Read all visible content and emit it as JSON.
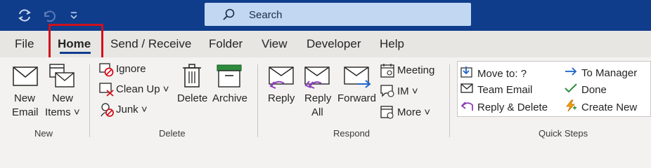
{
  "titlebar": {
    "sync_icon": "sync-icon",
    "undo_icon": "undo-icon",
    "customize_icon": "customize-quick-access-icon",
    "search_placeholder": "Search"
  },
  "tabs": [
    {
      "label": "File"
    },
    {
      "label": "Home"
    },
    {
      "label": "Send / Receive"
    },
    {
      "label": "Folder"
    },
    {
      "label": "View"
    },
    {
      "label": "Developer"
    },
    {
      "label": "Help"
    }
  ],
  "ribbon": {
    "new": {
      "group_label": "New",
      "new_email": [
        "New",
        "Email"
      ],
      "new_items": [
        "New",
        "Items ˅"
      ]
    },
    "delete": {
      "group_label": "Delete",
      "ignore": "Ignore",
      "clean_up": "Clean Up ˅",
      "junk": "Junk ˅",
      "delete": "Delete",
      "archive": "Archive"
    },
    "respond": {
      "group_label": "Respond",
      "reply": "Reply",
      "reply_all": [
        "Reply",
        "All"
      ],
      "forward": "Forward",
      "meeting": "Meeting",
      "im": "IM ˅",
      "more": "More ˅"
    },
    "quick_steps": {
      "group_label": "Quick Steps",
      "items": [
        {
          "label": "Move to: ?",
          "icon": "move-to-folder-icon"
        },
        {
          "label": "Team Email",
          "icon": "team-email-icon"
        },
        {
          "label": "Reply & Delete",
          "icon": "reply-delete-icon"
        },
        {
          "label": "To Manager",
          "icon": "forward-arrow-icon"
        },
        {
          "label": "Done",
          "icon": "checkmark-icon"
        },
        {
          "label": "Create New",
          "icon": "lightning-icon"
        }
      ]
    }
  },
  "colors": {
    "titlebar": "#0f3d8c",
    "search_bg": "#c2d8f2",
    "highlight_box": "#d0101c",
    "reply_purple": "#8b3fb8",
    "forward_blue": "#1e64c8"
  }
}
